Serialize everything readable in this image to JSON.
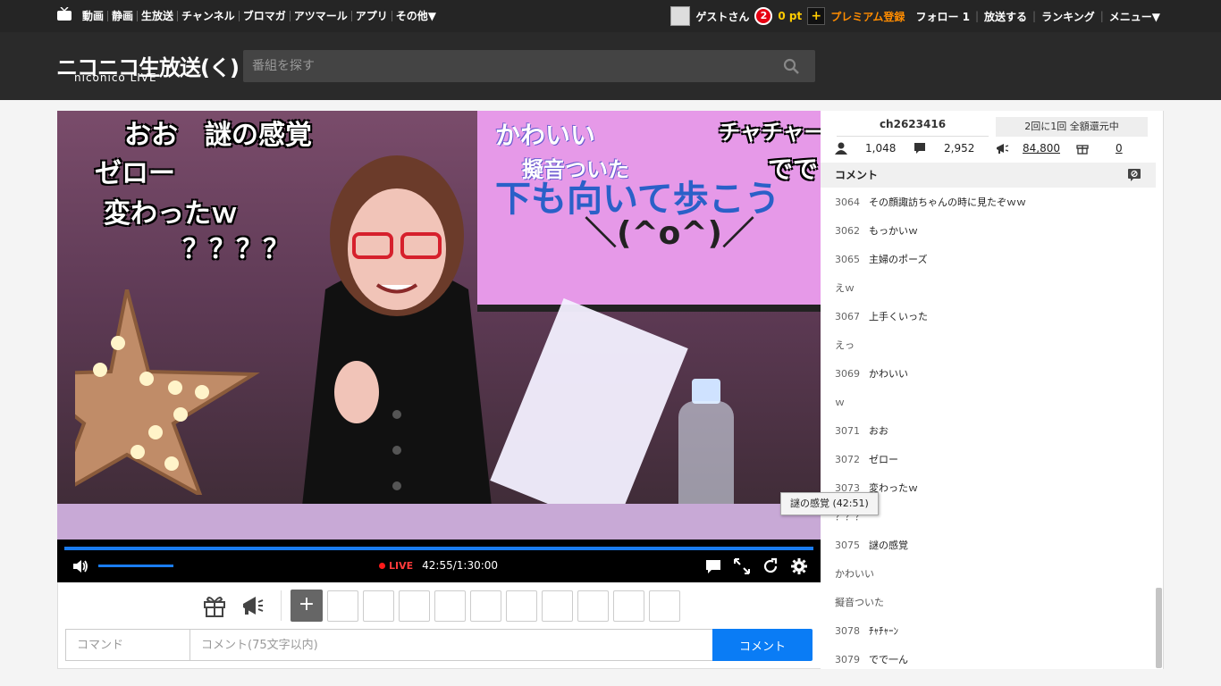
{
  "topnav": {
    "links": [
      "動画",
      "静画",
      "生放送",
      "チャンネル",
      "ブロマガ",
      "アツマール",
      "アプリ",
      "その他▼"
    ],
    "user": "ゲストさん",
    "notification_count": "2",
    "points": "0 pt",
    "plus": "+",
    "premium": "プレミアム登録",
    "follow": "フォロー 1",
    "broadcast": "放送する",
    "ranking": "ランキング",
    "menu": "メニュー▼"
  },
  "header": {
    "logo_main": "ニコニコ生放送(く)",
    "logo_sub": "niconico LIVE",
    "search_placeholder": "番組を探す"
  },
  "video_overlay": {
    "left": [
      "おお　謎の感覚",
      "ゼロー",
      "変わったｗ",
      "？？？？"
    ],
    "screen": [
      "かわいい",
      "擬音ついた",
      "チャチャーン",
      "でで",
      "下も向いて歩こう",
      "＼(^o^)／"
    ]
  },
  "player": {
    "live_label": "LIVE",
    "time": "42:55/1:30:00",
    "progress_fraction": 1.0,
    "volume_fraction": 0.7
  },
  "items": {
    "add": "+"
  },
  "comment_form": {
    "command_placeholder": "コマンド",
    "comment_placeholder": "コメント(75文字以内)",
    "submit": "コメント"
  },
  "panel": {
    "channel": "ch2623416",
    "kangen": "2回に1回 全額還元中",
    "viewers": "1,048",
    "comments": "2,952",
    "ad_points": "84,800",
    "gifts": "0",
    "comment_heading": "コメント"
  },
  "comments": [
    {
      "no": "3064",
      "text": "その顔諏訪ちゃんの時に見たぞｗｗ"
    },
    {
      "no": "3062",
      "text": "もっかいｗ"
    },
    {
      "no": "3065",
      "text": "主婦のポーズ"
    },
    {
      "no": "",
      "text": "えｗ"
    },
    {
      "no": "3067",
      "text": "上手くいった"
    },
    {
      "no": "",
      "text": "えっ"
    },
    {
      "no": "3069",
      "text": "かわいい"
    },
    {
      "no": "",
      "text": "ｗ"
    },
    {
      "no": "3071",
      "text": "おお"
    },
    {
      "no": "3072",
      "text": "ゼロー"
    },
    {
      "no": "3073",
      "text": "変わったｗ"
    },
    {
      "no": "",
      "text": "？？？"
    },
    {
      "no": "3075",
      "text": "謎の感覚"
    },
    {
      "no": "",
      "text": "かわいい"
    },
    {
      "no": "",
      "text": "擬音ついた"
    },
    {
      "no": "3078",
      "text": "ﾁｬﾁｬｰﾝ"
    },
    {
      "no": "3079",
      "text": "でで一ん"
    }
  ],
  "tooltip": "謎の感覚 (42:51)",
  "colors": {
    "accent": "#0a7cf5",
    "live_red": "#ff3b3b",
    "premium_orange": "#ff8c00",
    "header_bg": "#2a2a2a"
  }
}
